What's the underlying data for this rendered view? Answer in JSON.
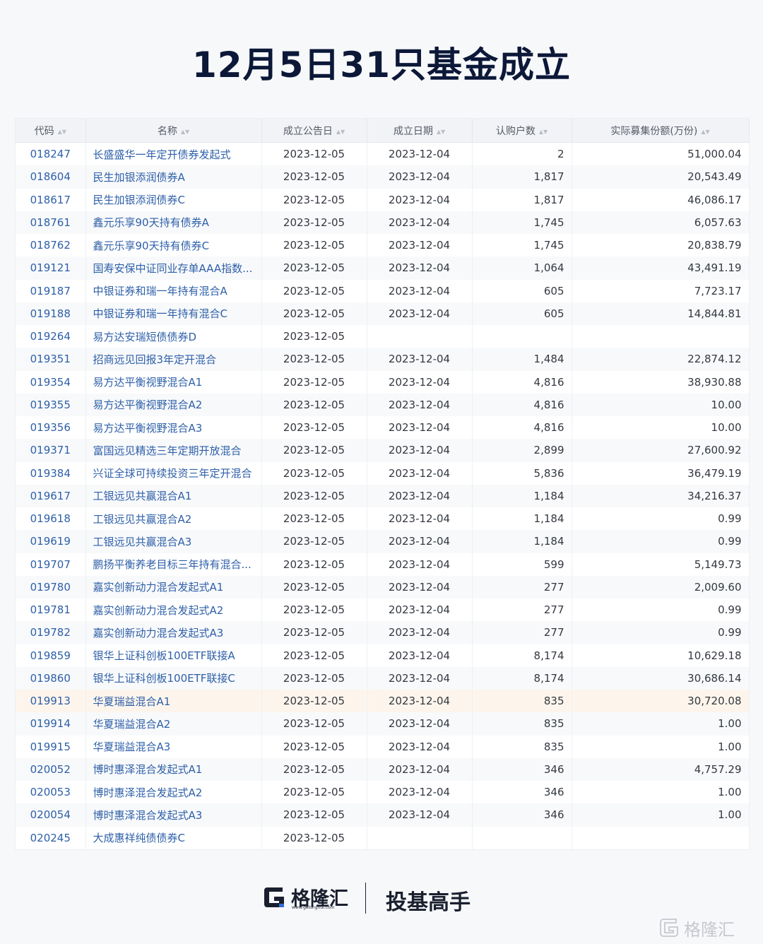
{
  "title": "12月5日31只基金成立",
  "table": {
    "headers": [
      "代码",
      "名称",
      "成立公告日",
      "成立日期",
      "认购户数",
      "实际募集份额(万份)"
    ],
    "rows": [
      [
        "018247",
        "长盛盛华一年定开债券发起式",
        "2023-12-05",
        "2023-12-04",
        "2",
        "51,000.04"
      ],
      [
        "018604",
        "民生加银添润债券A",
        "2023-12-05",
        "2023-12-04",
        "1,817",
        "20,543.49"
      ],
      [
        "018617",
        "民生加银添润债券C",
        "2023-12-05",
        "2023-12-04",
        "1,817",
        "46,086.17"
      ],
      [
        "018761",
        "鑫元乐享90天持有债券A",
        "2023-12-05",
        "2023-12-04",
        "1,745",
        "6,057.63"
      ],
      [
        "018762",
        "鑫元乐享90天持有债券C",
        "2023-12-05",
        "2023-12-04",
        "1,745",
        "20,838.79"
      ],
      [
        "019121",
        "国寿安保中证同业存单AAA指数...",
        "2023-12-05",
        "2023-12-04",
        "1,064",
        "43,491.19"
      ],
      [
        "019187",
        "中银证券和瑞一年持有混合A",
        "2023-12-05",
        "2023-12-04",
        "605",
        "7,723.17"
      ],
      [
        "019188",
        "中银证券和瑞一年持有混合C",
        "2023-12-05",
        "2023-12-04",
        "605",
        "14,844.81"
      ],
      [
        "019264",
        "易方达安瑞短债债券D",
        "2023-12-05",
        "",
        "",
        ""
      ],
      [
        "019351",
        "招商远见回报3年定开混合",
        "2023-12-05",
        "2023-12-04",
        "1,484",
        "22,874.12"
      ],
      [
        "019354",
        "易方达平衡视野混合A1",
        "2023-12-05",
        "2023-12-04",
        "4,816",
        "38,930.88"
      ],
      [
        "019355",
        "易方达平衡视野混合A2",
        "2023-12-05",
        "2023-12-04",
        "4,816",
        "10.00"
      ],
      [
        "019356",
        "易方达平衡视野混合A3",
        "2023-12-05",
        "2023-12-04",
        "4,816",
        "10.00"
      ],
      [
        "019371",
        "富国远见精选三年定期开放混合",
        "2023-12-05",
        "2023-12-04",
        "2,899",
        "27,600.92"
      ],
      [
        "019384",
        "兴证全球可持续投资三年定开混合",
        "2023-12-05",
        "2023-12-04",
        "5,836",
        "36,479.19"
      ],
      [
        "019617",
        "工银远见共赢混合A1",
        "2023-12-05",
        "2023-12-04",
        "1,184",
        "34,216.37"
      ],
      [
        "019618",
        "工银远见共赢混合A2",
        "2023-12-05",
        "2023-12-04",
        "1,184",
        "0.99"
      ],
      [
        "019619",
        "工银远见共赢混合A3",
        "2023-12-05",
        "2023-12-04",
        "1,184",
        "0.99"
      ],
      [
        "019707",
        "鹏扬平衡养老目标三年持有混合...",
        "2023-12-05",
        "2023-12-04",
        "599",
        "5,149.73"
      ],
      [
        "019780",
        "嘉实创新动力混合发起式A1",
        "2023-12-05",
        "2023-12-04",
        "277",
        "2,009.60"
      ],
      [
        "019781",
        "嘉实创新动力混合发起式A2",
        "2023-12-05",
        "2023-12-04",
        "277",
        "0.99"
      ],
      [
        "019782",
        "嘉实创新动力混合发起式A3",
        "2023-12-05",
        "2023-12-04",
        "277",
        "0.99"
      ],
      [
        "019859",
        "银华上证科创板100ETF联接A",
        "2023-12-05",
        "2023-12-04",
        "8,174",
        "10,629.18"
      ],
      [
        "019860",
        "银华上证科创板100ETF联接C",
        "2023-12-05",
        "2023-12-04",
        "8,174",
        "30,686.14"
      ],
      [
        "019913",
        "华夏瑞益混合A1",
        "2023-12-05",
        "2023-12-04",
        "835",
        "30,720.08"
      ],
      [
        "019914",
        "华夏瑞益混合A2",
        "2023-12-05",
        "2023-12-04",
        "835",
        "1.00"
      ],
      [
        "019915",
        "华夏瑞益混合A3",
        "2023-12-05",
        "2023-12-04",
        "835",
        "1.00"
      ],
      [
        "020052",
        "博时惠泽混合发起式A1",
        "2023-12-05",
        "2023-12-04",
        "346",
        "4,757.29"
      ],
      [
        "020053",
        "博时惠泽混合发起式A2",
        "2023-12-05",
        "2023-12-04",
        "346",
        "1.00"
      ],
      [
        "020054",
        "博时惠泽混合发起式A3",
        "2023-12-05",
        "2023-12-04",
        "346",
        "1.00"
      ],
      [
        "020245",
        "大成惠祥纯债债券C",
        "2023-12-05",
        "",
        "",
        ""
      ]
    ],
    "highlighted_row": 24
  },
  "footer": {
    "logo_text": "格隆汇",
    "logo_url": "www.gelonghui.com",
    "slogan": "投基高手"
  },
  "watermark": "格隆汇",
  "colors": {
    "title": "#0c1838",
    "link": "#2d5fa8",
    "header_bg": "#f2f3f6",
    "highlight_bg": "#fdf5ec",
    "logo_blue": "#2f6fd6"
  },
  "icons": {
    "sort": "sort-icon",
    "logo": "gelonghui-logo-icon"
  }
}
